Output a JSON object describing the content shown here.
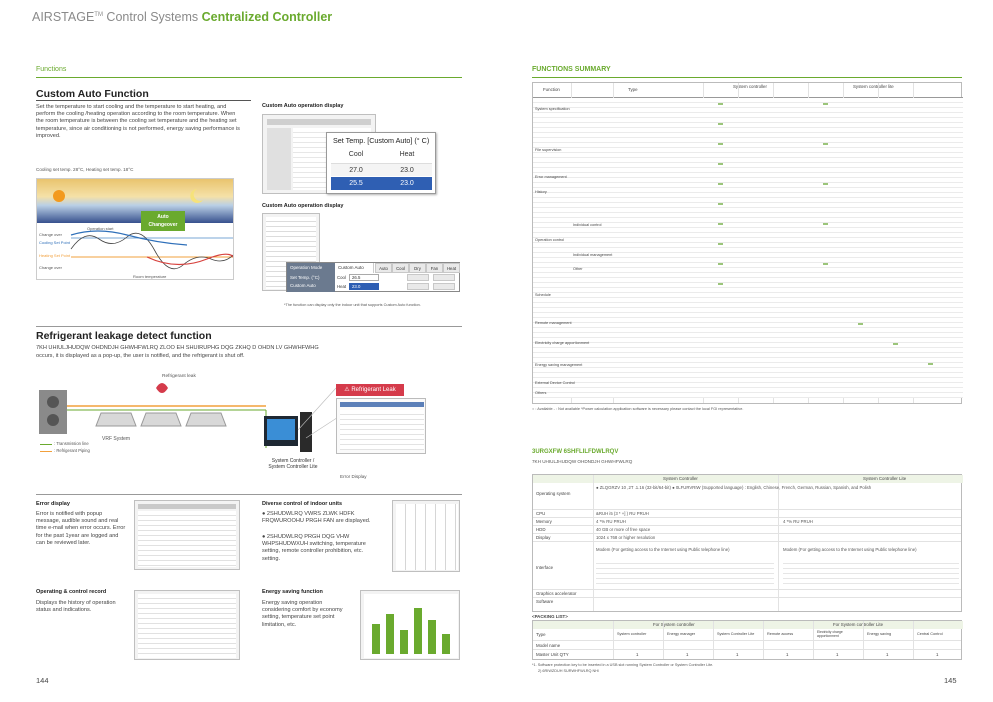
{
  "header": {
    "brand_prefix": "AIRSTAGE",
    "brand_tm": "TM",
    "brand_mid": " Control Systems ",
    "brand_product": "Centralized Controller"
  },
  "left": {
    "section_label": "Functions",
    "custom_auto": {
      "title": "Custom  Auto Function",
      "body": "Set the temperature to start cooling and the temperature to start heating, and perform the cooling /heating operation according to the room temperature. When the room temperature is between  the cooling set temperature and the heating set temperature,  since air conditioning is not performed, energy saving performance  is improved.",
      "example": "Cooling  set  temp. 28°C, Heating set temp. 18°C",
      "diagram": {
        "start_label": "Operation start",
        "auto_badge_line1": "Auto",
        "auto_badge_line2": "Changeover",
        "changeover_1": "Change over",
        "cooling_set_point": "Cooling Set Point",
        "heating_set_point": "Heating Set Point",
        "changeover_2": "Change over",
        "room_temp": "Room temperature"
      },
      "display1": {
        "caption": "Custom Auto operation display",
        "popup_title": "Set Temp. [Custom Auto] (° C)",
        "col_cool": "Cool",
        "col_heat": "Heat",
        "rows": [
          {
            "cool": "27.0",
            "heat": "23.0"
          },
          {
            "cool": "25.5",
            "heat": "23.0"
          }
        ]
      },
      "display2": {
        "caption": "Custom Auto operation display",
        "mode_label": "Operation Mode",
        "mode_value": "Custom Auto",
        "mode_buttons": [
          "Auto",
          "Cool",
          "Dry",
          "Fan",
          "Heat"
        ],
        "set_temp_label": "Set Temp. (°C)",
        "custom_auto_label": "Custom Auto",
        "cool_label": "Cool",
        "cool_value": "26.5",
        "heat_label": "Heat",
        "heat_value": "23.0",
        "footnote": "*The  function can display only the indoor unit that supports Custom Auto function."
      }
    },
    "refrigerant": {
      "title": "Refrigerant leakage  detect function",
      "body_line1": "7KH UHIULJHUDQW OHDNDJH GHWHFWLRQ ZLOO EH SHUIRUPHG DQG ZKHQ D OHDN LV GHWHFWHG",
      "body_line2": "occurs, it is displayed as a pop-up, the user is notified, and the refrigerant is shut off.",
      "leak_label": "Refrigerant leak",
      "popup_label": "Refrigerant Leak",
      "vrf_label": "VRF System",
      "legend_transmission": ": Transmission line",
      "legend_piping": ": Refrigerant Piping",
      "controller_label_1": "System Controller /",
      "controller_label_2": "System Controller Lite",
      "error_display_label": "Error Display"
    },
    "features": [
      {
        "title": "Error display",
        "body": "Error is notified with popup message, audible sound and real time e-mail when error occurs. Error for the past 1year are logged and can be reviewed later."
      },
      {
        "title": "Diverse control of indoor units",
        "body_items": [
          "●  2SHUDWLRQ VWRS ZLWK HDFK FRQWUROOHU PRGH  FAN are displayed.",
          "●  2SHUDWLRQ PRGH DQG VHW WHPSHUDWXUH switching, temperature setting, remote controller prohibition, etc. setting."
        ]
      },
      {
        "title": "Operating & control record",
        "body": "Displays the history of operation status and indications."
      },
      {
        "title": "Energy saving function",
        "body": "Energy saving operation considering comfort by economy setting, temperature set point limitation, etc."
      }
    ],
    "page_number": "144"
  },
  "right": {
    "section_title": "FUNCTIONS SUMMARY",
    "table_header": {
      "function": "Function",
      "type": "Type",
      "system_controller": "System controller",
      "system_controller_lite": "System controller lite"
    },
    "function_groups": [
      "System specification",
      "File supervision",
      "Error management",
      "History",
      "Operation control",
      "Schedule",
      "Remote management",
      "Electricity charge apportionment",
      "Energy saving management",
      "External Device Control",
      "Others"
    ],
    "sub_groups": [
      "Individual control",
      "Individual management",
      "Other"
    ],
    "table_footnote": "○ : Available   - : Not available  *Power calculation application software is necessary please contact the local FGI representative.",
    "spec_title": "3URGXFW 6SHFLILFDWLRQV",
    "spec_subtitle": "7KH UHIULJHUDQW OHDNDJH GHWHFWLRQ",
    "spec_header": {
      "sc": "System Controller",
      "scl": "System Controller Lite"
    },
    "spec_rows": [
      {
        "label": "Operating system",
        "sc": "● ZLQGRZV 10 ,2T .1.16 (32-bit/64-bit) ● 0LFURVRIW (Supported language) : English, Chinese, French, German, Russian, Spanish, and Polish",
        "scl": ""
      },
      {
        "label": "CPU",
        "sc": "&RUH i5 (3 * +] ) RU PRUH",
        "scl": ""
      },
      {
        "label": "Memory",
        "sc": "4 *% RU PRUH",
        "scl": "4 *% RU PRUH"
      },
      {
        "label": "HDD",
        "sc": "40 GB or more of free space",
        "scl": ""
      },
      {
        "label": "Display",
        "sc": "1024 x 768 or higher resolution",
        "scl": ""
      },
      {
        "label": "Interface",
        "sc": "Modem (For getting access to the Internet using Public telephone line)",
        "scl": "Modem (For getting access to the Internet using Public telephone line)"
      },
      {
        "label": "Graphics accelerator",
        "sc": "",
        "scl": ""
      },
      {
        "label": "Software",
        "sc": "",
        "scl": ""
      }
    ],
    "packing_title": "<PACKING LIST>",
    "packing_header": {
      "sc": "For System controller",
      "scl": "For System controller Lite"
    },
    "packing_type_label": "Type",
    "packing_model_label": "Model name",
    "packing_qty_label": "Master Unit QTY",
    "packing_cols": [
      "System controller",
      "Energy manager",
      "System Controller Lite",
      "Remote access",
      "Electricity charge apportionment",
      "Energy saving",
      "Central Control"
    ],
    "packing_qty": [
      "1",
      "1",
      "1",
      "1",
      "1",
      "1",
      "1"
    ],
    "notes_line1": "*1. Software protection key to be inserted in a USB slot running System Controller or System Controller Lite.",
    "notes_line2": "2) 6RIWZDUH SURWHFWLRQ NH\\",
    "page_number": "145"
  },
  "colors": {
    "accent_green": "#6aaa2e",
    "popup_red": "#d53b4b",
    "highlight_blue": "#2f5fb3",
    "orange_line": "#f2a03c"
  }
}
